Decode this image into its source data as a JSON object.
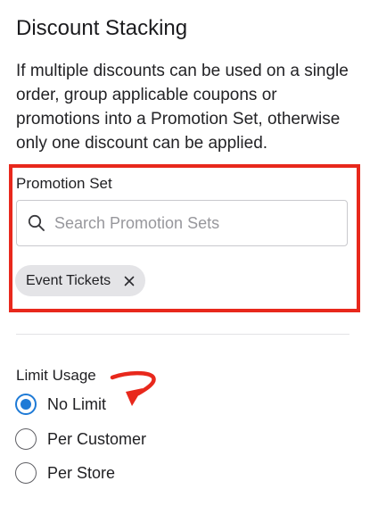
{
  "section": {
    "title": "Discount Stacking",
    "description": "If multiple discounts can be used on a single order, group applicable coupons or promotions into a Promotion Set, otherwise only one discount can be applied."
  },
  "promotion_set": {
    "label": "Promotion Set",
    "search_placeholder": "Search Promotion Sets",
    "search_value": "",
    "selected_chips": [
      {
        "label": "Event Tickets"
      }
    ]
  },
  "limit_usage": {
    "label": "Limit Usage",
    "selected_index": 0,
    "options": [
      {
        "label": "No Limit",
        "checked": true
      },
      {
        "label": "Per Customer",
        "checked": false
      },
      {
        "label": "Per Store",
        "checked": false
      }
    ]
  },
  "icons": {
    "search": "search-icon",
    "chip_remove": "close-icon",
    "annotation_arrow": "curved-arrow-icon"
  },
  "colors": {
    "highlight_border": "#e8281c",
    "radio_accent": "#1e7ad6",
    "chip_background": "#e4e4e7"
  }
}
